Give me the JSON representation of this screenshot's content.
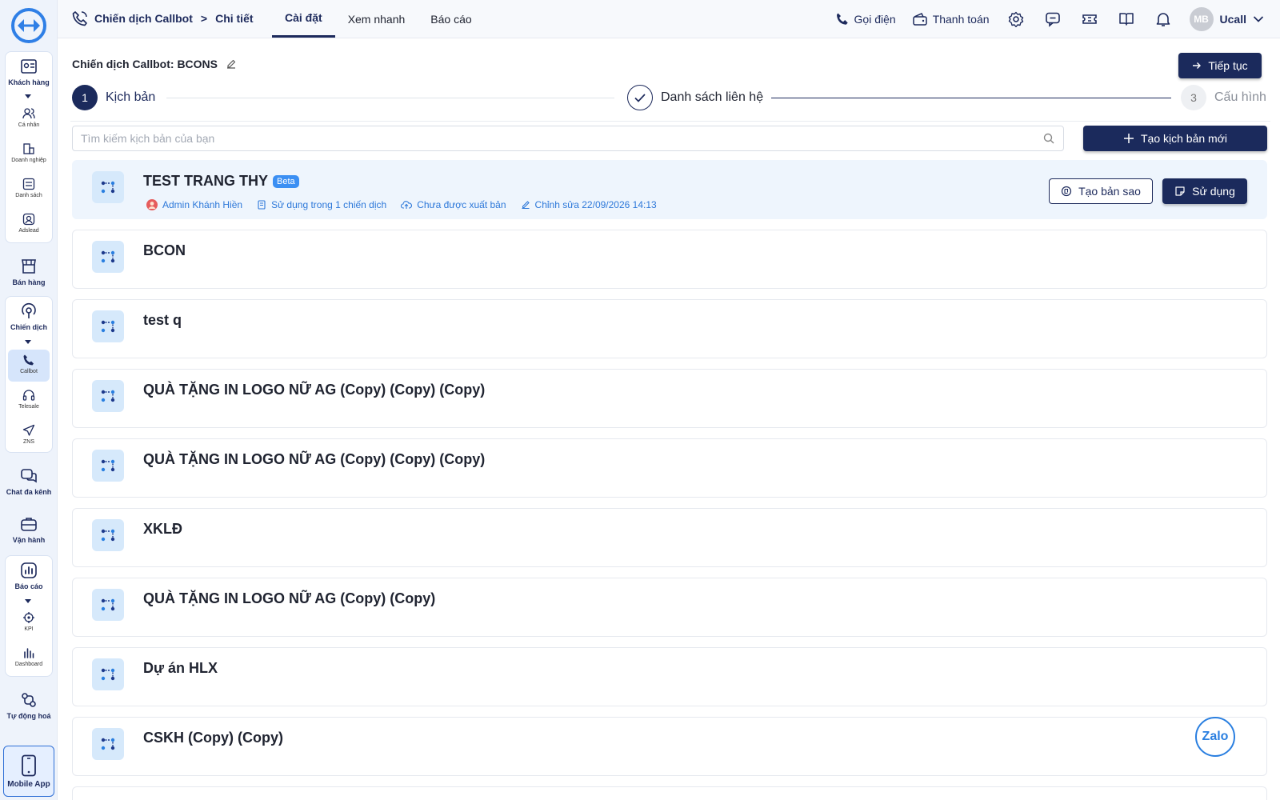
{
  "sidebar": {
    "customers": {
      "label": "Khách hàng",
      "sub": [
        "Cá nhân",
        "Doanh nghiệp",
        "Danh sách",
        "Adslead"
      ]
    },
    "sales": "Bán hàng",
    "campaign": {
      "label": "Chiến dịch",
      "sub": [
        "Callbot",
        "Telesale",
        "ZNS"
      ]
    },
    "chat": "Chat đa kênh",
    "ops": "Vận hành",
    "reports": {
      "label": "Báo cáo",
      "sub": [
        "KPI",
        "Dashboard"
      ]
    },
    "automation": "Tự động hoá",
    "mobile": "Mobile App"
  },
  "topbar": {
    "breadcrumb": [
      "Chiến dịch Callbot",
      "Chi tiết"
    ],
    "breadcrumb_sep": ">",
    "tabs": [
      "Cài đặt",
      "Xem nhanh",
      "Báo cáo"
    ],
    "call": "Gọi điện",
    "payment": "Thanh toán",
    "avatar": "MB",
    "user": "Ucall"
  },
  "campaign": {
    "title": "Chiến dịch Callbot: BCONS",
    "next": "Tiếp tục"
  },
  "steps": [
    {
      "num": "1",
      "label": "Kịch bản"
    },
    {
      "num": "",
      "label": "Danh sách liên hệ"
    },
    {
      "num": "3",
      "label": "Cấu hình"
    }
  ],
  "search": {
    "placeholder": "Tìm kiếm kịch bản của bạn"
  },
  "new_script": "Tạo kịch bản mới",
  "scripts": [
    {
      "title": "TEST TRANG THY",
      "badge": "Beta",
      "author": "Admin Khánh Hiền",
      "usage": "Sử dụng trong 1 chiến dịch",
      "publish": "Chưa được xuất bản",
      "edited": "Chỉnh sửa 22/09/2026 14:13",
      "copy": "Tạo bản sao",
      "use": "Sử dụng"
    },
    {
      "title": "BCON"
    },
    {
      "title": "test q"
    },
    {
      "title": "QUÀ TẶNG IN LOGO NỮ AG (Copy) (Copy) (Copy)"
    },
    {
      "title": "QUÀ TẶNG IN LOGO NỮ AG (Copy) (Copy) (Copy)"
    },
    {
      "title": "XKLĐ"
    },
    {
      "title": "QUÀ TẶNG IN LOGO NỮ AG (Copy) (Copy)"
    },
    {
      "title": "Dự án HLX"
    },
    {
      "title": "CSKH (Copy) (Copy)"
    }
  ],
  "zalo": "Zalo",
  "colors": {
    "primary": "#1b2a5c",
    "accent": "#2d78d9",
    "selected_bg": "#eef5fd"
  }
}
